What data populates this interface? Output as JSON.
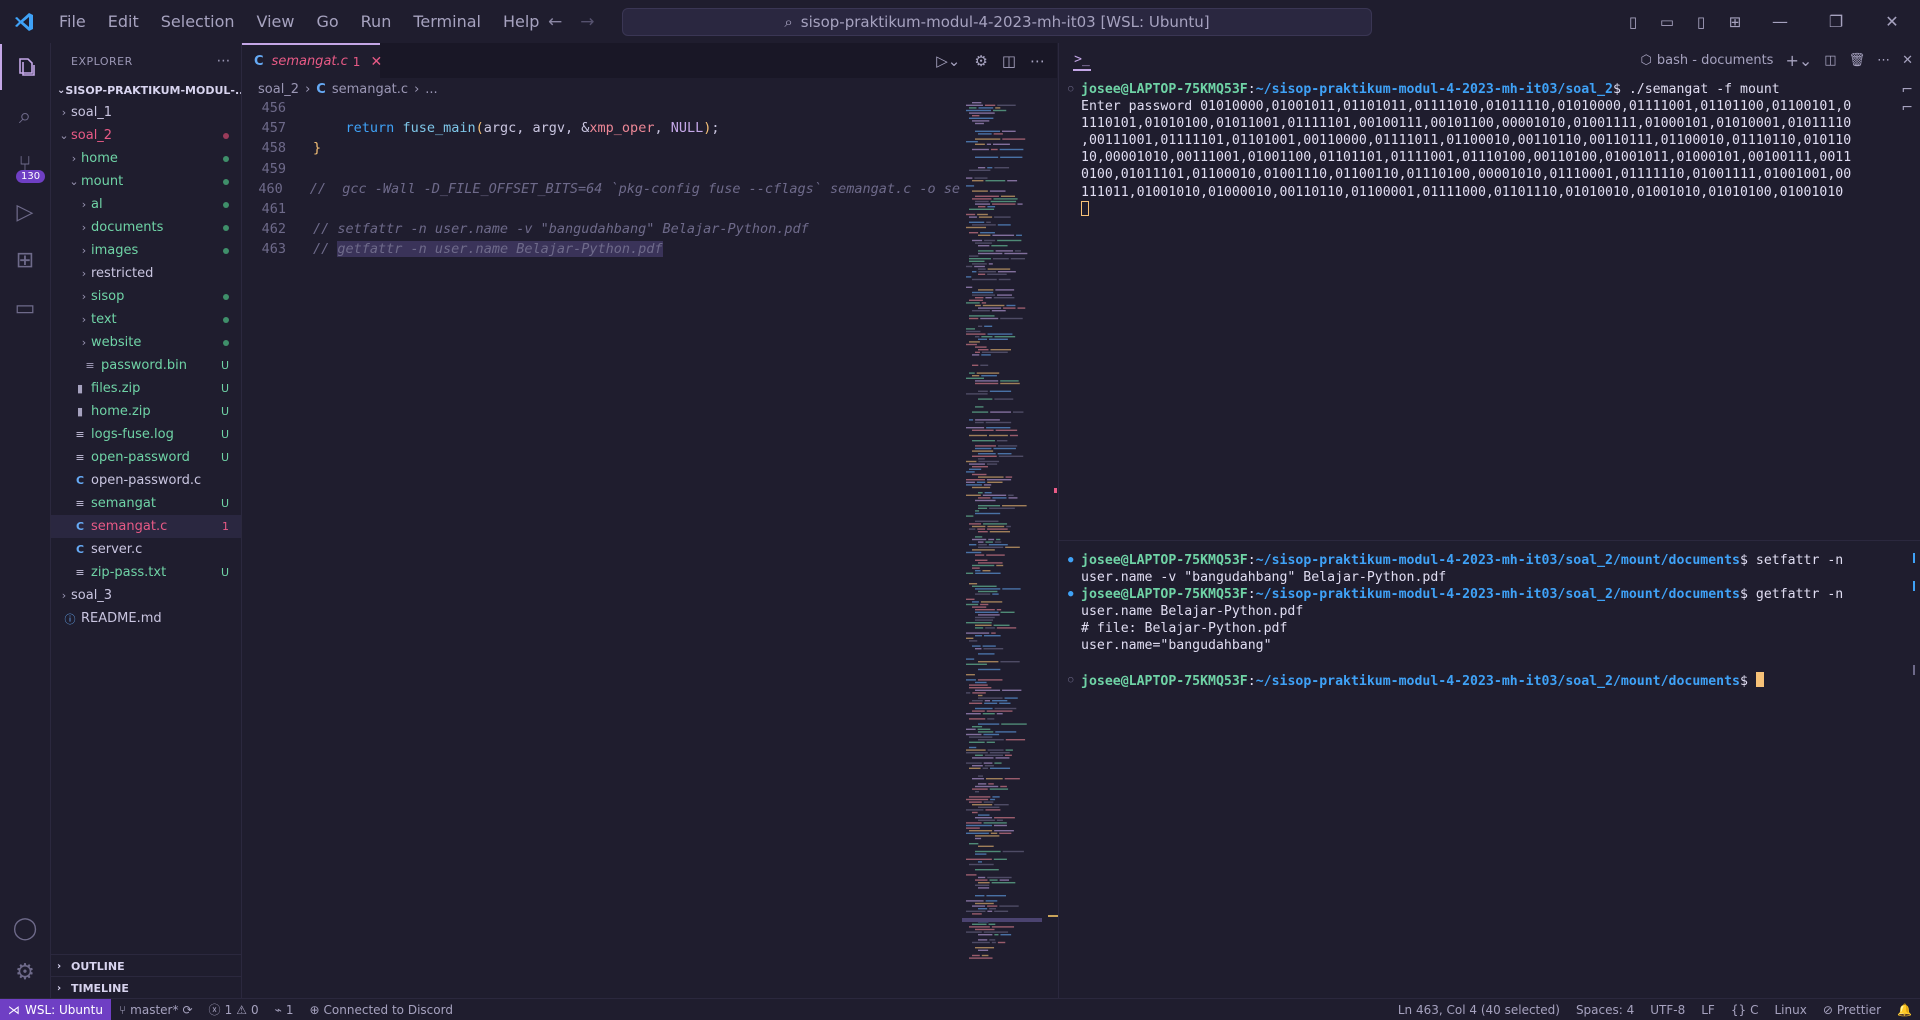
{
  "window": {
    "command_center": "sisop-praktikum-modul-4-2023-mh-it03 [WSL: Ubuntu]",
    "menu": [
      "File",
      "Edit",
      "Selection",
      "View",
      "Go",
      "Run",
      "Terminal",
      "Help"
    ]
  },
  "activity_bar": {
    "scm_badge": "130"
  },
  "explorer": {
    "title": "EXPLORER",
    "root": "SISOP-PRAKTIKUM-MODUL-...",
    "items": [
      {
        "label": "soal_1",
        "depth": 0,
        "type": "folder",
        "open": false,
        "color": "default",
        "deco": ""
      },
      {
        "label": "soal_2",
        "depth": 0,
        "type": "folder",
        "open": true,
        "color": "error",
        "deco": "dot-error"
      },
      {
        "label": "home",
        "depth": 1,
        "type": "folder",
        "open": false,
        "color": "untracked",
        "deco": "dot-untracked"
      },
      {
        "label": "mount",
        "depth": 1,
        "type": "folder",
        "open": true,
        "color": "untracked",
        "deco": "dot-untracked"
      },
      {
        "label": "al",
        "depth": 2,
        "type": "folder",
        "open": false,
        "color": "untracked",
        "deco": "dot-untracked"
      },
      {
        "label": "documents",
        "depth": 2,
        "type": "folder",
        "open": false,
        "color": "untracked",
        "deco": "dot-untracked"
      },
      {
        "label": "images",
        "depth": 2,
        "type": "folder",
        "open": false,
        "color": "untracked",
        "deco": "dot-untracked"
      },
      {
        "label": "restricted",
        "depth": 2,
        "type": "folder",
        "open": false,
        "color": "default",
        "deco": ""
      },
      {
        "label": "sisop",
        "depth": 2,
        "type": "folder",
        "open": false,
        "color": "untracked",
        "deco": "dot-untracked"
      },
      {
        "label": "text",
        "depth": 2,
        "type": "folder",
        "open": false,
        "color": "untracked",
        "deco": "dot-untracked"
      },
      {
        "label": "website",
        "depth": 2,
        "type": "folder",
        "open": false,
        "color": "untracked",
        "deco": "dot-untracked"
      },
      {
        "label": "password.bin",
        "depth": 2,
        "type": "file-bin",
        "color": "untracked",
        "deco": "U"
      },
      {
        "label": "files.zip",
        "depth": 1,
        "type": "file-zip",
        "color": "untracked",
        "deco": "U"
      },
      {
        "label": "home.zip",
        "depth": 1,
        "type": "file-zip",
        "color": "untracked",
        "deco": "U"
      },
      {
        "label": "logs-fuse.log",
        "depth": 1,
        "type": "file-text",
        "color": "untracked",
        "deco": "U"
      },
      {
        "label": "open-password",
        "depth": 1,
        "type": "file-text",
        "color": "untracked",
        "deco": "U"
      },
      {
        "label": "open-password.c",
        "depth": 1,
        "type": "file-c",
        "color": "default",
        "deco": ""
      },
      {
        "label": "semangat",
        "depth": 1,
        "type": "file-text",
        "color": "untracked",
        "deco": "U"
      },
      {
        "label": "semangat.c",
        "depth": 1,
        "type": "file-c",
        "color": "error",
        "deco": "1"
      },
      {
        "label": "server.c",
        "depth": 1,
        "type": "file-c",
        "color": "default",
        "deco": ""
      },
      {
        "label": "zip-pass.txt",
        "depth": 1,
        "type": "file-text",
        "color": "untracked",
        "deco": "U"
      },
      {
        "label": "soal_3",
        "depth": 0,
        "type": "folder",
        "open": false,
        "color": "default",
        "deco": ""
      },
      {
        "label": "README.md",
        "depth": 0,
        "type": "file-info",
        "color": "default",
        "deco": ""
      }
    ],
    "outline": "OUTLINE",
    "timeline": "TIMELINE"
  },
  "editor": {
    "tab": {
      "lang": "C",
      "name": "semangat.c",
      "problems": "1"
    },
    "breadcrumb": [
      "soal_2",
      "semangat.c",
      "..."
    ],
    "lines": [
      {
        "n": "456",
        "text": ""
      },
      {
        "n": "457",
        "text": "return fuse_main(argc, argv, &xmp_oper, NULL);"
      },
      {
        "n": "458",
        "text": "}"
      },
      {
        "n": "459",
        "text": ""
      },
      {
        "n": "460",
        "text": "//  gcc -Wall -D_FILE_OFFSET_BITS=64 `pkg-config fuse --cflags` semangat.c -o se"
      },
      {
        "n": "461",
        "text": ""
      },
      {
        "n": "462",
        "text": "// setfattr -n user.name -v \"bangudahbang\" Belajar-Python.pdf"
      },
      {
        "n": "463",
        "text": "// getfattr -n user.name Belajar-Python.pdf"
      }
    ]
  },
  "terminal": {
    "profile": "bash - documents",
    "top": {
      "prompt_user": "josee@LAPTOP-75KMQ53F",
      "prompt_path": "~/sisop-praktikum-modul-4-2023-mh-it03/soal_2",
      "command": "./semangat -f mount",
      "output": [
        "Enter password 01010000,01001011,01101011,01111010,01011110,01010000,01111001,01101100,01100101,0",
        "1110101,01010100,01011001,01111101,00100111,00101100,00001010,01001111,01000101,01010001,01011110",
        ",00111001,01111101,01101001,00110000,01111011,01100010,00110110,00110111,01100010,01110110,010110",
        "10,00001010,00111001,01001100,01101101,01111001,01110100,00110100,01001011,01000101,00100111,0011",
        "0100,01011101,01100010,01001110,01100110,01110100,00001010,01110001,01111110,01001111,01001001,00",
        "111011,01001010,01000010,00110110,01100001,01111000,01101110,01010010,01001010,01010100,01001010"
      ]
    },
    "bottom": {
      "prompt_user": "josee@LAPTOP-75KMQ53F",
      "prompt_path": "~/sisop-praktikum-modul-4-2023-mh-it03/soal_2/mount/documents",
      "cmd1_a": "setfattr -n",
      "cmd1_b": "user.name -v \"bangudahbang\" Belajar-Python.pdf",
      "cmd2_a": "getfattr -n",
      "cmd2_b": "user.name Belajar-Python.pdf",
      "out1": "# file: Belajar-Python.pdf",
      "out2": "user.name=\"bangudahbang\""
    }
  },
  "statusbar": {
    "remote": "WSL: Ubuntu",
    "branch": "master*",
    "errors": "1",
    "warnings": "0",
    "ports": "1",
    "discord": "Connected to Discord",
    "position": "Ln 463, Col 4 (40 selected)",
    "spaces": "Spaces: 4",
    "encoding": "UTF-8",
    "eol": "LF",
    "language": "C",
    "os": "Linux",
    "prettier": "Prettier"
  }
}
